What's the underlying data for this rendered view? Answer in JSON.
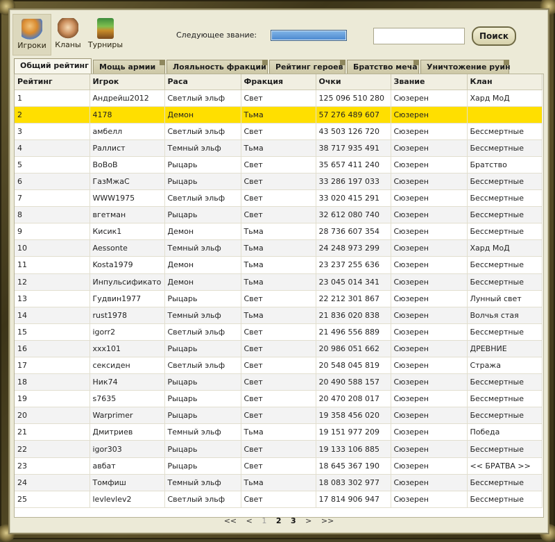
{
  "nav": {
    "items": [
      {
        "label": "Игроки",
        "active": true,
        "icon": "players-icon"
      },
      {
        "label": "Кланы",
        "active": false,
        "icon": "clans-icon"
      },
      {
        "label": "Турниры",
        "active": false,
        "icon": "tournaments-icon"
      }
    ]
  },
  "rank": {
    "label": "Следующее звание:",
    "progress": 1.0
  },
  "search": {
    "value": "",
    "placeholder": "",
    "button_label": "Поиск"
  },
  "tabs": [
    {
      "label": "Общий рейтинг",
      "active": true
    },
    {
      "label": "Мощь армии",
      "active": false
    },
    {
      "label": "Лояльность фракции",
      "active": false
    },
    {
      "label": "Рейтинг героев",
      "active": false
    },
    {
      "label": "Братство меча",
      "active": false
    },
    {
      "label": "Уничтожение руин",
      "active": false
    }
  ],
  "table": {
    "columns": [
      "Рейтинг",
      "Игрок",
      "Раса",
      "Фракция",
      "Очки",
      "Звание",
      "Клан"
    ],
    "rows": [
      [
        "1",
        "Андрейш2012",
        "Светлый эльф",
        "Свет",
        "125 096 510 280",
        "Сюзерен",
        "Хард МоД"
      ],
      [
        "2",
        "4178",
        "Демон",
        "Тьма",
        "57 276 489 607",
        "Сюзерен",
        ""
      ],
      [
        "3",
        "амбелл",
        "Светлый эльф",
        "Свет",
        "43 503 126 720",
        "Сюзерен",
        "Бессмертные"
      ],
      [
        "4",
        "Раллист",
        "Темный эльф",
        "Тьма",
        "38 717 935 491",
        "Сюзерен",
        "Бессмертные"
      ],
      [
        "5",
        "ВоВоВ",
        "Рыцарь",
        "Свет",
        "35 657 411 240",
        "Сюзерен",
        "Братство"
      ],
      [
        "6",
        "ГазМжаС",
        "Рыцарь",
        "Свет",
        "33 286 197 033",
        "Сюзерен",
        "Бессмертные"
      ],
      [
        "7",
        "WWW1975",
        "Светлый эльф",
        "Свет",
        "33 020 415 291",
        "Сюзерен",
        "Бессмертные"
      ],
      [
        "8",
        "вгетман",
        "Рыцарь",
        "Свет",
        "32 612 080 740",
        "Сюзерен",
        "Бессмертные"
      ],
      [
        "9",
        "Кисик1",
        "Демон",
        "Тьма",
        "28 736 607 354",
        "Сюзерен",
        "Бессмертные"
      ],
      [
        "10",
        "Aessonte",
        "Темный эльф",
        "Тьма",
        "24 248 973 299",
        "Сюзерен",
        "Хард МоД"
      ],
      [
        "11",
        "Kosta1979",
        "Демон",
        "Тьма",
        "23 237 255 636",
        "Сюзерен",
        "Бессмертные"
      ],
      [
        "12",
        "Инпульсификато",
        "Демон",
        "Тьма",
        "23 045 014 341",
        "Сюзерен",
        "Бессмертные"
      ],
      [
        "13",
        "Гудвин1977",
        "Рыцарь",
        "Свет",
        "22 212 301 867",
        "Сюзерен",
        "Лунный свет"
      ],
      [
        "14",
        "rust1978",
        "Темный эльф",
        "Тьма",
        "21 836 020 838",
        "Сюзерен",
        "Волчья стая"
      ],
      [
        "15",
        "igorr2",
        "Светлый эльф",
        "Свет",
        "21 496 556 889",
        "Сюзерен",
        "Бессмертные"
      ],
      [
        "16",
        "xxx101",
        "Рыцарь",
        "Свет",
        "20 986 051 662",
        "Сюзерен",
        "ДРЕВНИЕ"
      ],
      [
        "17",
        "сексиден",
        "Светлый эльф",
        "Свет",
        "20 548 045 819",
        "Сюзерен",
        "Стража"
      ],
      [
        "18",
        "Ник74",
        "Рыцарь",
        "Свет",
        "20 490 588 157",
        "Сюзерен",
        "Бессмертные"
      ],
      [
        "19",
        "s7635",
        "Рыцарь",
        "Свет",
        "20 470 208 017",
        "Сюзерен",
        "Бессмертные"
      ],
      [
        "20",
        "Warprimer",
        "Рыцарь",
        "Свет",
        "19 358 456 020",
        "Сюзерен",
        "Бессмертные"
      ],
      [
        "21",
        "Дмитриев",
        "Темный эльф",
        "Тьма",
        "19 151 977 209",
        "Сюзерен",
        "Победа"
      ],
      [
        "22",
        "igor303",
        "Рыцарь",
        "Свет",
        "19 133 106 885",
        "Сюзерен",
        "Бессмертные"
      ],
      [
        "23",
        "авбат",
        "Рыцарь",
        "Свет",
        "18 645 367 190",
        "Сюзерен",
        "<< БРАТВА >>"
      ],
      [
        "24",
        "Томфиш",
        "Темный эльф",
        "Тьма",
        "18 083 302 977",
        "Сюзерен",
        "Бессмертные"
      ],
      [
        "25",
        "levlevlev2",
        "Светлый эльф",
        "Свет",
        "17 814 906 947",
        "Сюзерен",
        "Бессмертные"
      ]
    ],
    "highlight_row": 1
  },
  "pagination": {
    "first": "<<",
    "prev": "<",
    "pages": [
      "1",
      "2",
      "3"
    ],
    "current": "1",
    "next": ">",
    "last": ">>"
  },
  "colors": {
    "highlight": "#ffdf00",
    "panel": "#ecead7",
    "frame": "#4a4325"
  }
}
